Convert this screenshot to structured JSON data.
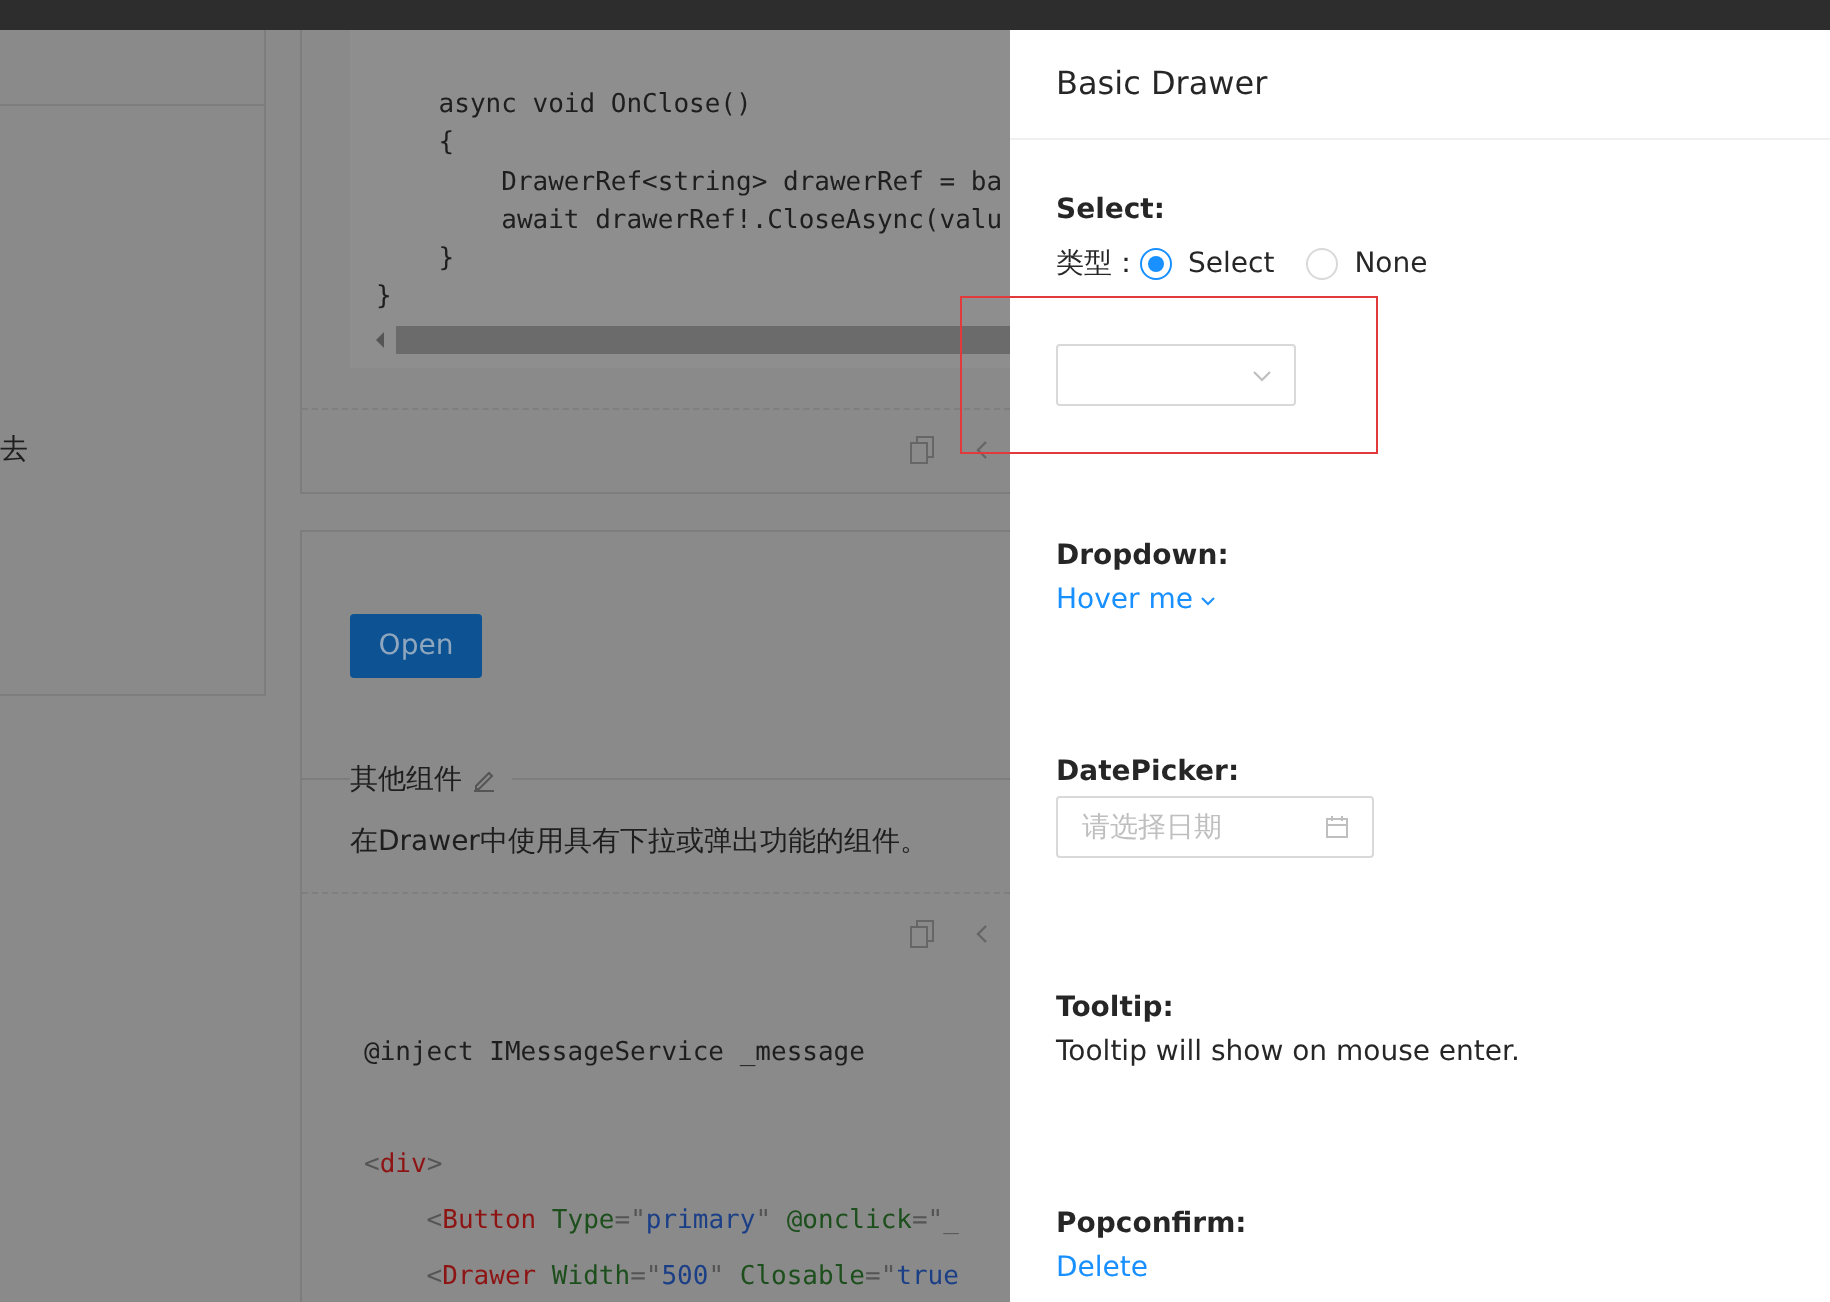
{
  "left_panel": {
    "text": "去"
  },
  "demo_card": {
    "code_groups": [
      [
        "    async void OnClose()",
        "    {",
        "        DrawerRef<string> drawerRef = ba",
        "        await drawerRef!.CloseAsync(valu",
        "    }",
        "}"
      ]
    ]
  },
  "other_card": {
    "button": "Open",
    "title": "其他组件",
    "description": "在Drawer中使用具有下拉或弹出功能的组件。",
    "code_groups": [
      [
        [
          {
            "kind": "plain",
            "text": "@inject IMessageService _message"
          }
        ]
      ],
      [
        [
          {
            "kind": "punct",
            "text": "<"
          },
          {
            "kind": "tag",
            "text": "div"
          },
          {
            "kind": "punct",
            "text": ">"
          }
        ],
        [
          {
            "kind": "punct",
            "text": "    <"
          },
          {
            "kind": "tag",
            "text": "Button"
          },
          {
            "kind": "attr",
            "text": " Type"
          },
          {
            "kind": "punct",
            "text": "=\""
          },
          {
            "kind": "string",
            "text": "primary"
          },
          {
            "kind": "punct",
            "text": "\""
          },
          {
            "kind": "attr",
            "text": " @onclick"
          },
          {
            "kind": "punct",
            "text": "=\"_"
          }
        ],
        [
          {
            "kind": "punct",
            "text": "    <"
          },
          {
            "kind": "tag",
            "text": "Drawer"
          },
          {
            "kind": "attr",
            "text": " Width"
          },
          {
            "kind": "punct",
            "text": "=\""
          },
          {
            "kind": "string",
            "text": "500"
          },
          {
            "kind": "punct",
            "text": "\""
          },
          {
            "kind": "attr",
            "text": " Closable"
          },
          {
            "kind": "punct",
            "text": "=\""
          },
          {
            "kind": "string",
            "text": "true"
          }
        ]
      ]
    ]
  },
  "drawer": {
    "title": "Basic Drawer",
    "sections": [
      {
        "kind": "select",
        "label": "Select:",
        "radio_label": "类型：",
        "options": [
          {
            "label": "Select",
            "selected": true
          },
          {
            "label": "None",
            "selected": false
          }
        ]
      },
      {
        "kind": "dropdown",
        "label": "Dropdown:",
        "link": "Hover me"
      },
      {
        "kind": "datepicker",
        "label": "DatePicker:",
        "placeholder": "请选择日期"
      },
      {
        "kind": "tooltip",
        "label": "Tooltip:",
        "text": "Tooltip will show on mouse enter."
      },
      {
        "kind": "popconfirm",
        "label": "Popconfirm:",
        "link": "Delete"
      }
    ]
  }
}
